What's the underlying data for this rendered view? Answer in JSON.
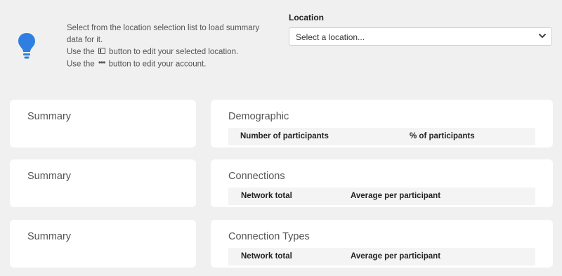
{
  "info": {
    "icon": "lightbulb-icon",
    "line1a": "Select from the location selection list to load summary",
    "line1b": "data for it.",
    "line2_before": "Use the",
    "line2_icon": "panel-icon",
    "line2_after": "button to edit your selected location.",
    "line3_before": "Use the",
    "line3_icon": "more-dots-icon",
    "line3_after": "button to edit your account."
  },
  "location": {
    "label": "Location",
    "placeholder": "Select a location...",
    "chevron_icon": "chevron-down-icon"
  },
  "summary_cards": [
    {
      "title": "Summary"
    },
    {
      "title": "Summary"
    },
    {
      "title": "Summary"
    }
  ],
  "detail_cards": [
    {
      "title": "Demographic",
      "columns": [
        "Number of participants",
        "% of participants"
      ]
    },
    {
      "title": "Connections",
      "columns": [
        "Network total",
        "Average per participant"
      ]
    },
    {
      "title": "Connection Types",
      "columns": [
        "Network total",
        "Average per participant"
      ]
    }
  ],
  "colors": {
    "background": "#f0f0f0",
    "accent": "#2f7fe0",
    "card": "#ffffff",
    "table_header": "#f4f4f4"
  }
}
